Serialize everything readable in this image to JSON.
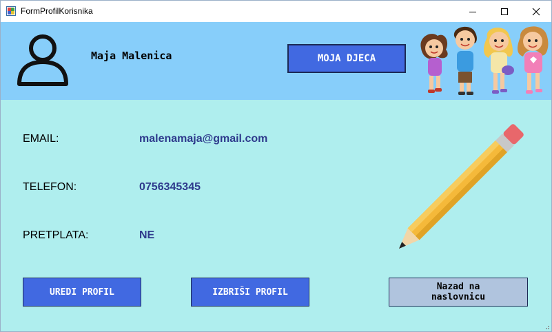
{
  "window": {
    "title": "FormProfilKorisnika"
  },
  "header": {
    "user_name": "Maja Malenica",
    "kids_button": "MOJA DJECA"
  },
  "profile": {
    "email_label": "EMAIL:",
    "email_value": "malenamaja@gmail.com",
    "phone_label": "TELEFON:",
    "phone_value": "0756345345",
    "subscription_label": "PRETPLATA:",
    "subscription_value": "NE"
  },
  "actions": {
    "edit_button": "UREDI PROFIL",
    "delete_button": "IZBRIŠI PROFIL",
    "back_button": "Nazad na\nnaslovnicu"
  },
  "icons": [
    "app-icon",
    "minimize-icon",
    "maximize-icon",
    "close-icon",
    "user-avatar-icon",
    "children-illustration",
    "pencil-icon",
    "resize-grip-icon"
  ],
  "colors": {
    "body_bg": "#afeeee",
    "header_bg": "#87cefa",
    "primary_button": "#4169e1",
    "secondary_button": "#b0c4de",
    "value_text": "#2e3a8c"
  }
}
